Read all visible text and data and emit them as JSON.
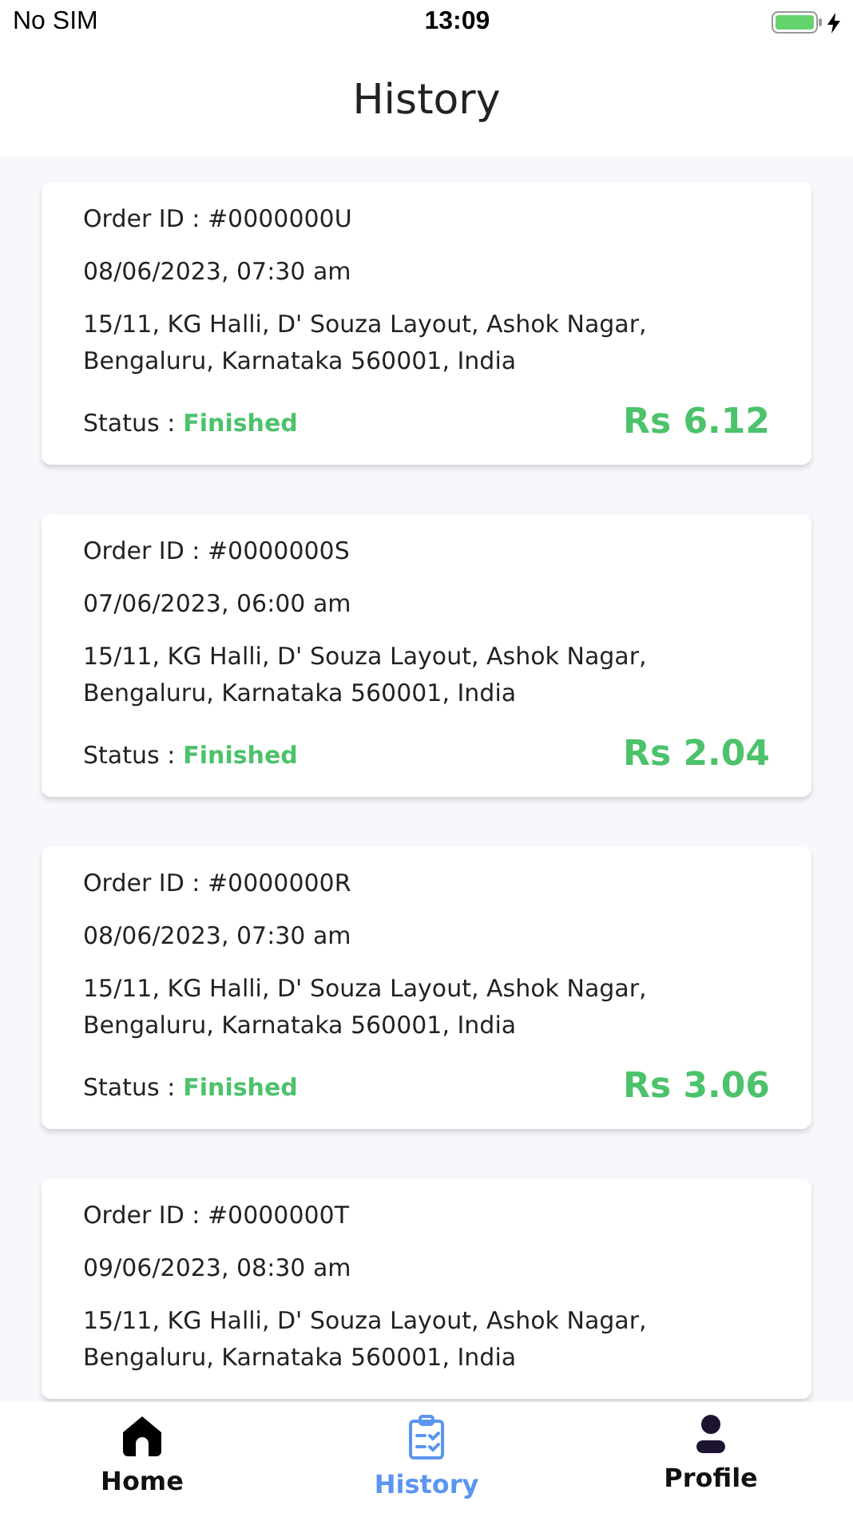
{
  "status_bar": {
    "carrier": "No SIM",
    "time": "13:09"
  },
  "header": {
    "title": "History"
  },
  "orders": [
    {
      "order_id": "Order ID : #0000000U",
      "datetime": "08/06/2023, 07:30 am",
      "address": "15/11, KG Halli, D' Souza Layout, Ashok Nagar, Bengaluru, Karnataka 560001, India",
      "status_label": "Status :",
      "status": "Finished",
      "amount": "Rs 6.12"
    },
    {
      "order_id": "Order ID : #0000000S",
      "datetime": "07/06/2023, 06:00 am",
      "address": "15/11, KG Halli, D' Souza Layout, Ashok Nagar, Bengaluru, Karnataka 560001, India",
      "status_label": "Status :",
      "status": "Finished",
      "amount": "Rs 2.04"
    },
    {
      "order_id": "Order ID : #0000000R",
      "datetime": "08/06/2023, 07:30 am",
      "address": "15/11, KG Halli, D' Souza Layout, Ashok Nagar, Bengaluru, Karnataka 560001, India",
      "status_label": "Status :",
      "status": "Finished",
      "amount": "Rs 3.06"
    },
    {
      "order_id": "Order ID : #0000000T",
      "datetime": "09/06/2023, 08:30 am",
      "address": "15/11, KG Halli, D' Souza Layout, Ashok Nagar, Bengaluru, Karnataka 560001, India"
    }
  ],
  "tabs": [
    {
      "kind": "home",
      "label": "Home",
      "selected": false
    },
    {
      "kind": "history",
      "label": "History",
      "selected": true
    },
    {
      "kind": "profile",
      "label": "Profile",
      "selected": false
    }
  ]
}
